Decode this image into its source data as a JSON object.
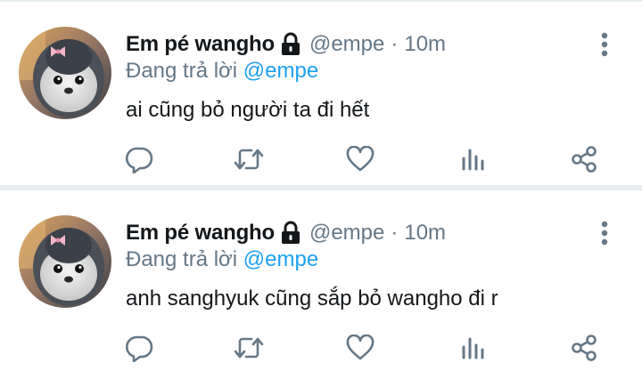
{
  "colors": {
    "name": "#14171a",
    "meta": "#657786",
    "mention": "#1da1f2",
    "icon": "#657786",
    "divider": "#e9ecef"
  },
  "tweets": [
    {
      "display_name": "Em pé wangho",
      "handle": "@empe",
      "separator": "·",
      "time": "10m",
      "reply_prefix": "Đang trả lời",
      "reply_mention": "@empe",
      "text": "ai cũng bỏ người ta đi hết",
      "icons": [
        "lock-icon",
        "more-vertical-icon",
        "reply-icon",
        "retweet-icon",
        "like-icon",
        "stats-icon",
        "share-icon"
      ]
    },
    {
      "display_name": "Em pé wangho",
      "handle": "@empe",
      "separator": "·",
      "time": "10m",
      "reply_prefix": "Đang trả lời",
      "reply_mention": "@empe",
      "text": "anh sanghyuk cũng sắp bỏ wangho đi r",
      "icons": [
        "lock-icon",
        "more-vertical-icon",
        "reply-icon",
        "retweet-icon",
        "like-icon",
        "stats-icon",
        "share-icon"
      ]
    }
  ]
}
